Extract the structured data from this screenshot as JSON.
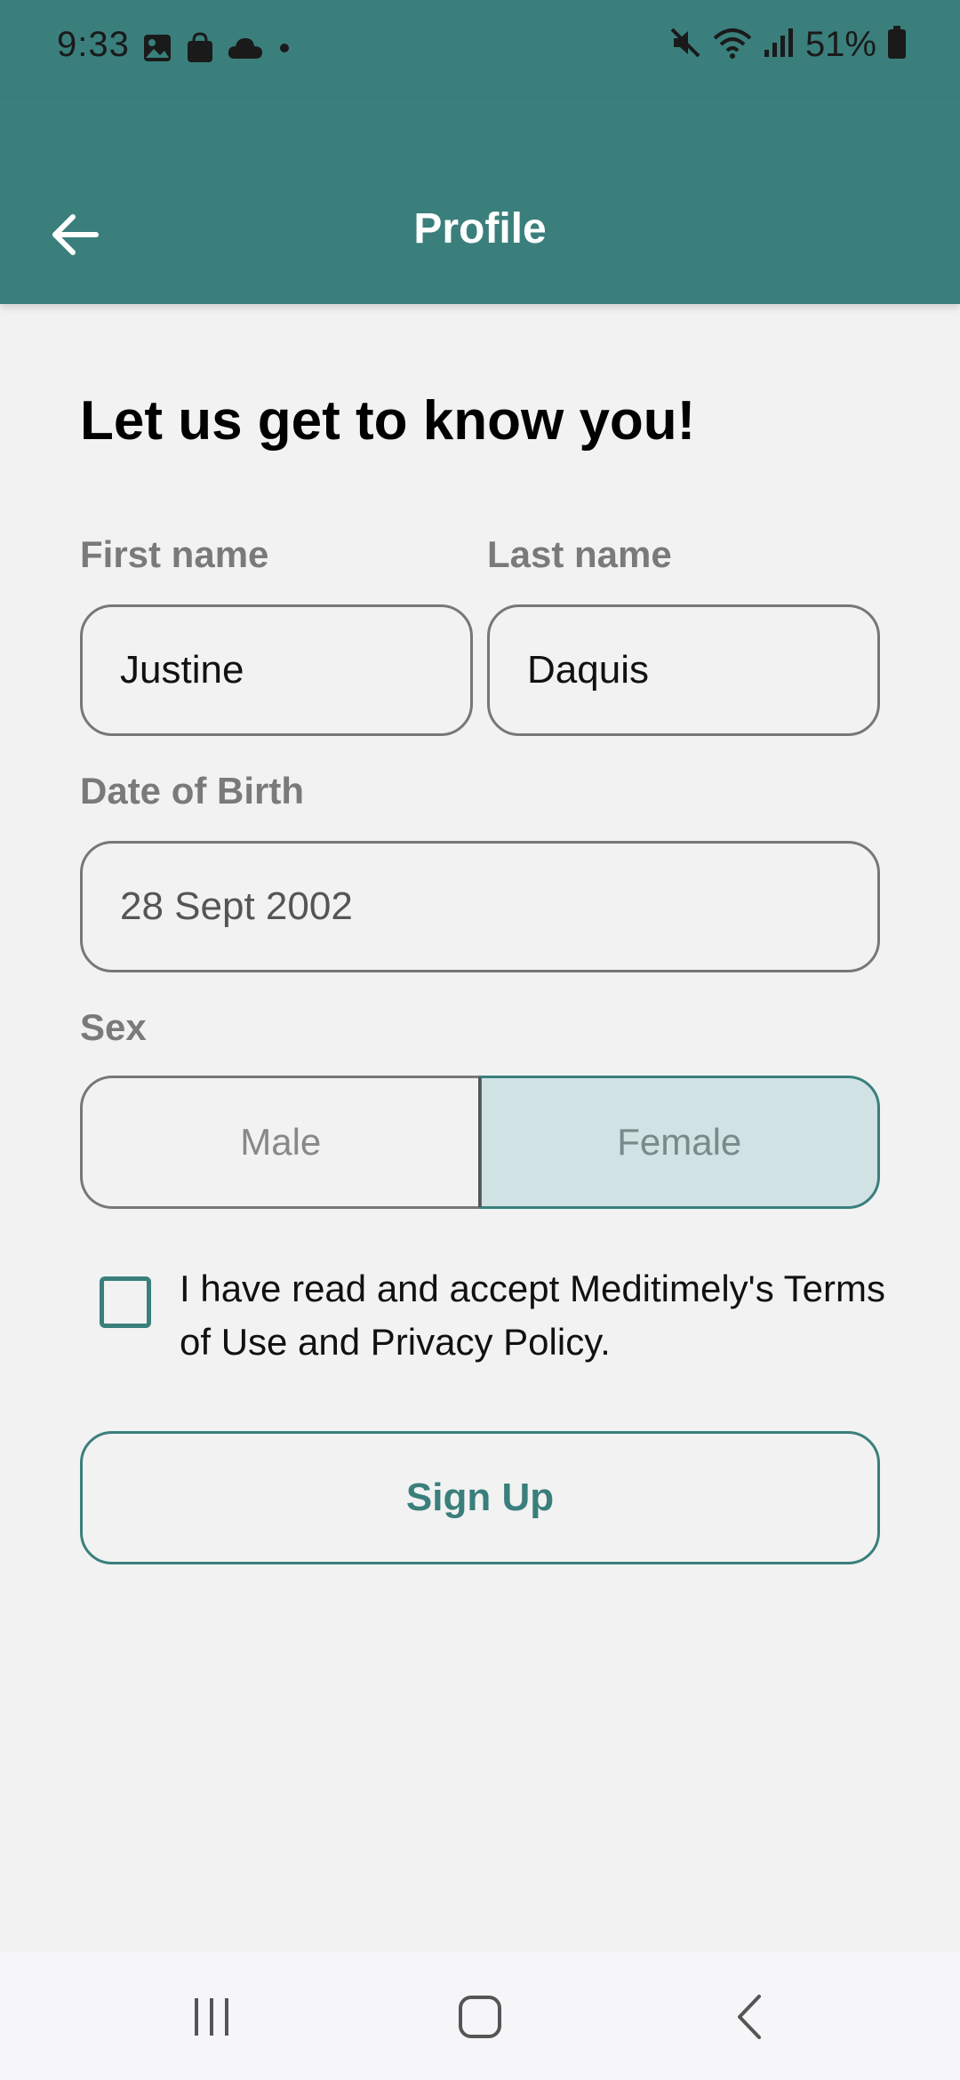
{
  "status_bar": {
    "time": "9:33",
    "battery": "51%",
    "icons": [
      "image-icon",
      "shopping-bag-icon",
      "cloud-icon",
      "dot-icon",
      "mute-icon",
      "wifi-icon",
      "signal-icon",
      "battery-icon"
    ]
  },
  "app_bar": {
    "title": "Profile",
    "back_icon": "arrow-left-icon",
    "background": "#3a7f7c"
  },
  "form": {
    "headline": "Let us get to know you!",
    "first_name": {
      "label": "First name",
      "value": "Justine"
    },
    "last_name": {
      "label": "Last name",
      "value": "Daquis"
    },
    "dob": {
      "label": "Date of Birth",
      "value": "28 Sept 2002"
    },
    "sex": {
      "label": "Sex",
      "options": [
        "Male",
        "Female"
      ],
      "selected": "Female"
    },
    "terms": {
      "text": "I have read and accept Meditimely's Terms of Use and Privacy Policy.",
      "checked": false
    },
    "submit_label": "Sign Up"
  },
  "nav_bar": {
    "buttons": [
      "recent-apps-icon",
      "home-icon",
      "back-icon"
    ]
  },
  "colors": {
    "accent": "#3a7f7c",
    "selected_fill": "#d0e2e4",
    "background": "#f2f2f2"
  }
}
